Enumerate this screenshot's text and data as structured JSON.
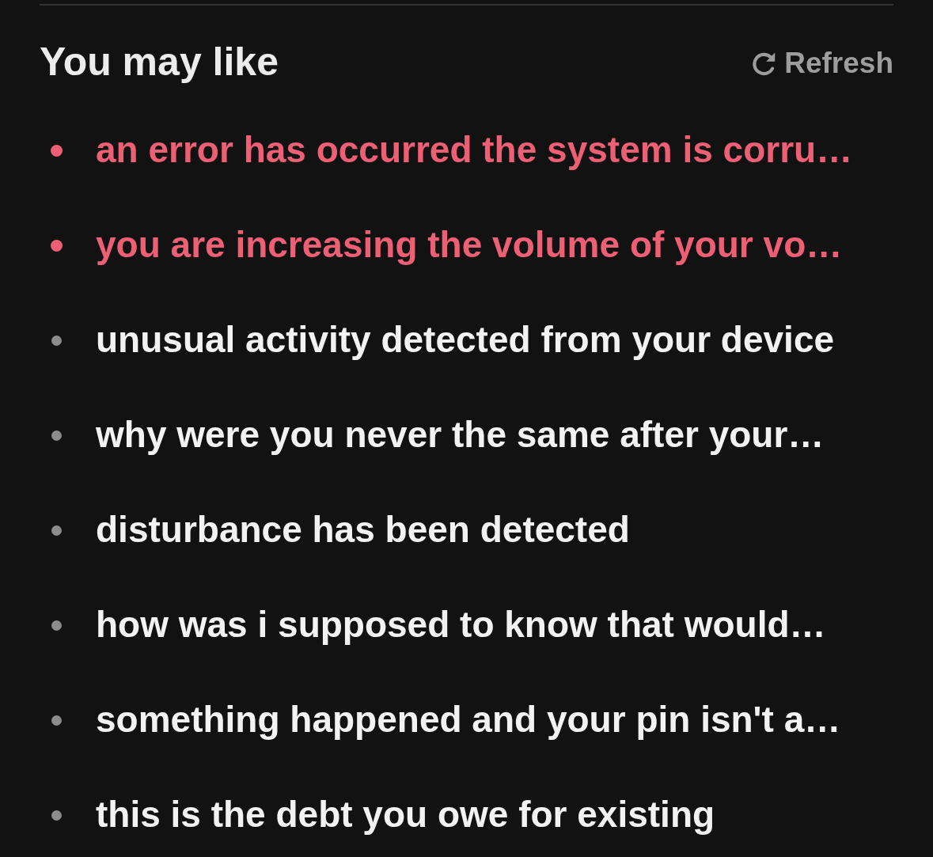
{
  "header": {
    "title": "You may like",
    "refresh_button": "Refresh"
  },
  "items": [
    {
      "text": "an error has occurred the system is corru…",
      "highlighted": true
    },
    {
      "text": "you are increasing the volume of your vo…",
      "highlighted": true
    },
    {
      "text": "unusual activity detected from your device",
      "highlighted": false
    },
    {
      "text": "why were you never the same after your…",
      "highlighted": false
    },
    {
      "text": "disturbance has been detected",
      "highlighted": false
    },
    {
      "text": "how was i supposed to know that would…",
      "highlighted": false
    },
    {
      "text": "something happened and your pin isn't a…",
      "highlighted": false
    },
    {
      "text": "this is the debt you owe for existing",
      "highlighted": false
    }
  ]
}
